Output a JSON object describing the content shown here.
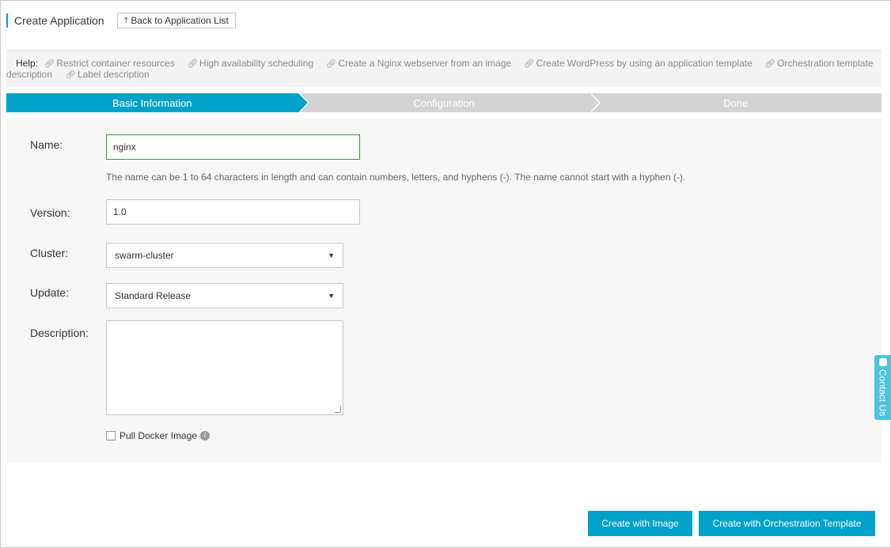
{
  "header": {
    "title": "Create Application",
    "back_label": "Back to Application List"
  },
  "help": {
    "label": "Help:",
    "links": [
      "Restrict container resources",
      "High availability scheduling",
      "Create a Nginx webserver from an image",
      "Create WordPress by using an application template",
      "Orchestration template",
      "description",
      "Label description"
    ]
  },
  "steps": [
    {
      "label": "Basic Information",
      "active": true
    },
    {
      "label": "Configuration",
      "active": false
    },
    {
      "label": "Done",
      "active": false
    }
  ],
  "form": {
    "name_label": "Name:",
    "name_value": "nginx",
    "name_hint": "The name can be 1 to 64 characters in length and can contain numbers, letters, and hyphens (-). The name cannot start with a hyphen (-).",
    "version_label": "Version:",
    "version_value": "1.0",
    "cluster_label": "Cluster:",
    "cluster_value": "swarm-cluster",
    "update_label": "Update:",
    "update_value": "Standard Release",
    "description_label": "Description:",
    "description_value": "",
    "pull_label": "Pull Docker Image",
    "pull_checked": false
  },
  "actions": {
    "create_image": "Create with Image",
    "create_template": "Create with Orchestration Template"
  },
  "contact": {
    "label": "Contact Us"
  },
  "colors": {
    "accent": "#00a2ca",
    "step_inactive": "#d3d3d3",
    "focus_border": "#3d9140"
  }
}
